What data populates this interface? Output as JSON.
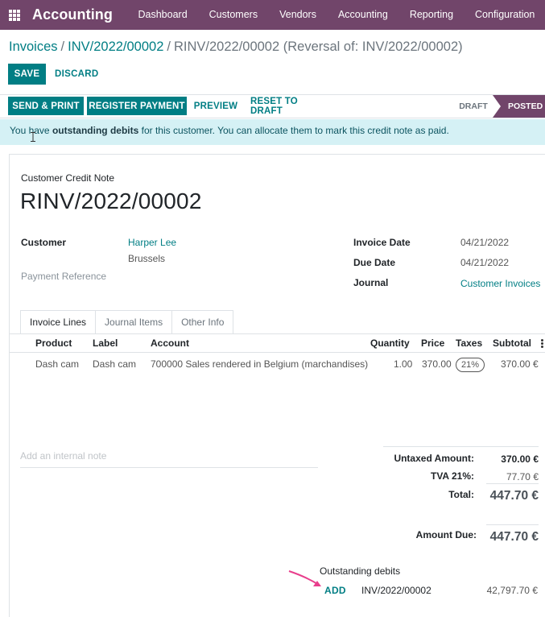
{
  "navbar": {
    "apps_icon": "apps-grid-icon",
    "brand": "Accounting",
    "menu": [
      "Dashboard",
      "Customers",
      "Vendors",
      "Accounting",
      "Reporting",
      "Configuration"
    ],
    "color": "#71456a"
  },
  "breadcrumb": {
    "items": [
      "Invoices",
      "INV/2022/00002"
    ],
    "current": "RINV/2022/00002 (Reversal of: INV/2022/00002)"
  },
  "form_actions": {
    "save": "SAVE",
    "discard": "DISCARD"
  },
  "statusbar": {
    "buttons": [
      "SEND & PRINT",
      "REGISTER PAYMENT",
      "PREVIEW",
      "RESET TO DRAFT"
    ],
    "stages": {
      "draft": "DRAFT",
      "posted": "POSTED"
    },
    "current_stage": "POSTED"
  },
  "alert": {
    "prefix": "You have ",
    "bold": "outstanding debits",
    "suffix": " for this customer. You can allocate them to mark this credit note as paid."
  },
  "document": {
    "type": "Customer Credit Note",
    "name": "RINV/2022/00002"
  },
  "fields": {
    "customer_label": "Customer",
    "customer_name": "Harper Lee",
    "customer_city": "Brussels",
    "payment_reference_label": "Payment Reference",
    "invoice_date_label": "Invoice Date",
    "invoice_date": "04/21/2022",
    "due_date_label": "Due Date",
    "due_date": "04/21/2022",
    "journal_label": "Journal",
    "journal": "Customer Invoices"
  },
  "tabs": [
    "Invoice Lines",
    "Journal Items",
    "Other Info"
  ],
  "active_tab": "Invoice Lines",
  "lines": {
    "columns": [
      "Product",
      "Label",
      "Account",
      "Quantity",
      "Price",
      "Taxes",
      "Subtotal"
    ],
    "rows": [
      {
        "product": "Dash cam",
        "label": "Dash cam",
        "account": "700000 Sales rendered in Belgium (marchandises)",
        "quantity": "1.00",
        "price": "370.00",
        "taxes": "21%",
        "subtotal": "370.00 €"
      }
    ]
  },
  "note_placeholder": "Add an internal note",
  "totals": {
    "untaxed_label": "Untaxed Amount:",
    "untaxed": "370.00 €",
    "tax_label": "TVA 21%:",
    "tax": "77.70 €",
    "total_label": "Total:",
    "total": "447.70 €",
    "amount_due_label": "Amount Due:",
    "amount_due": "447.70 €"
  },
  "outstanding": {
    "title": "Outstanding debits",
    "add": "ADD",
    "reference": "INV/2022/00002",
    "amount": "42,797.70 €"
  }
}
